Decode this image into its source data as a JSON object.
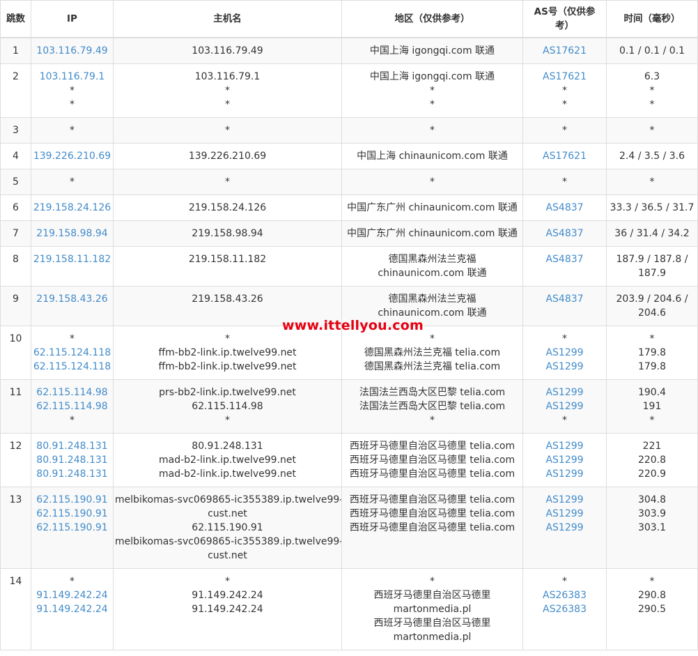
{
  "headers": {
    "hop": "跳数",
    "ip": "IP",
    "host": "主机名",
    "region": "地区（仅供参考）",
    "as": "AS号（仅供参考）",
    "time": "时间（毫秒）"
  },
  "watermark": "www.ittellyou.com",
  "rows": [
    {
      "hop": "1",
      "ip": [
        "103.116.79.49"
      ],
      "host": [
        "103.116.79.49"
      ],
      "region": [
        "中国上海 igongqi.com 联通"
      ],
      "as": [
        "AS17621"
      ],
      "time": [
        "0.1 / 0.1 / 0.1"
      ]
    },
    {
      "hop": "2",
      "ip": [
        "103.116.79.1",
        "*",
        "*"
      ],
      "host": [
        "103.116.79.1",
        "*",
        "*"
      ],
      "region": [
        "中国上海 igongqi.com 联通",
        "*",
        "*"
      ],
      "as": [
        "AS17621",
        "*",
        "*"
      ],
      "time": [
        "6.3",
        "*",
        "*"
      ]
    },
    {
      "hop": "3",
      "ip": [
        "*"
      ],
      "host": [
        "*"
      ],
      "region": [
        "*"
      ],
      "as": [
        "*"
      ],
      "time": [
        "*"
      ]
    },
    {
      "hop": "4",
      "ip": [
        "139.226.210.69"
      ],
      "host": [
        "139.226.210.69"
      ],
      "region": [
        "中国上海 chinaunicom.com 联通"
      ],
      "as": [
        "AS17621"
      ],
      "time": [
        "2.4 / 3.5 / 3.6"
      ]
    },
    {
      "hop": "5",
      "ip": [
        "*"
      ],
      "host": [
        "*"
      ],
      "region": [
        "*"
      ],
      "as": [
        "*"
      ],
      "time": [
        "*"
      ]
    },
    {
      "hop": "6",
      "ip": [
        "219.158.24.126"
      ],
      "host": [
        "219.158.24.126"
      ],
      "region": [
        "中国广东广州 chinaunicom.com 联通"
      ],
      "as": [
        "AS4837"
      ],
      "time": [
        "33.3 / 36.5 / 31.7"
      ]
    },
    {
      "hop": "7",
      "ip": [
        "219.158.98.94"
      ],
      "host": [
        "219.158.98.94"
      ],
      "region": [
        "中国广东广州 chinaunicom.com 联通"
      ],
      "as": [
        "AS4837"
      ],
      "time": [
        "36 / 31.4 / 34.2"
      ]
    },
    {
      "hop": "8",
      "ip": [
        "219.158.11.182"
      ],
      "host": [
        "219.158.11.182"
      ],
      "region": [
        "德国黑森州法兰克福",
        "chinaunicom.com 联通"
      ],
      "as": [
        "AS4837"
      ],
      "time": [
        "187.9 / 187.8 /",
        "187.9"
      ]
    },
    {
      "hop": "9",
      "ip": [
        "219.158.43.26"
      ],
      "host": [
        "219.158.43.26"
      ],
      "region": [
        "德国黑森州法兰克福",
        "chinaunicom.com 联通"
      ],
      "as": [
        "AS4837"
      ],
      "time": [
        "203.9 / 204.6 /",
        "204.6"
      ]
    },
    {
      "hop": "10",
      "ip": [
        "*",
        "62.115.124.118",
        "62.115.124.118"
      ],
      "host": [
        "*",
        "ffm-bb2-link.ip.twelve99.net",
        "ffm-bb2-link.ip.twelve99.net"
      ],
      "region": [
        "*",
        "德国黑森州法兰克福 telia.com",
        "德国黑森州法兰克福 telia.com"
      ],
      "as": [
        "*",
        "AS1299",
        "AS1299"
      ],
      "time": [
        "*",
        "179.8",
        "179.8"
      ]
    },
    {
      "hop": "11",
      "ip": [
        "62.115.114.98",
        "62.115.114.98",
        "*"
      ],
      "host": [
        "prs-bb2-link.ip.twelve99.net",
        "62.115.114.98",
        "*"
      ],
      "region": [
        "法国法兰西岛大区巴黎 telia.com",
        "法国法兰西岛大区巴黎 telia.com",
        "*"
      ],
      "as": [
        "AS1299",
        "AS1299",
        "*"
      ],
      "time": [
        "190.4",
        "191",
        "*"
      ]
    },
    {
      "hop": "12",
      "ip": [
        "80.91.248.131",
        "80.91.248.131",
        "80.91.248.131"
      ],
      "host": [
        "80.91.248.131",
        "mad-b2-link.ip.twelve99.net",
        "mad-b2-link.ip.twelve99.net"
      ],
      "region": [
        "西班牙马德里自治区马德里 telia.com",
        "西班牙马德里自治区马德里 telia.com",
        "西班牙马德里自治区马德里 telia.com"
      ],
      "as": [
        "AS1299",
        "AS1299",
        "AS1299"
      ],
      "time": [
        "221",
        "220.8",
        "220.9"
      ]
    },
    {
      "hop": "13",
      "ip": [
        "62.115.190.91",
        "62.115.190.91",
        "62.115.190.91"
      ],
      "host": [
        "melbikomas-svc069865-ic355389.ip.twelve99-",
        "cust.net",
        "62.115.190.91",
        "melbikomas-svc069865-ic355389.ip.twelve99-",
        "cust.net"
      ],
      "region": [
        "西班牙马德里自治区马德里 telia.com",
        "西班牙马德里自治区马德里 telia.com",
        "西班牙马德里自治区马德里 telia.com"
      ],
      "as": [
        "AS1299",
        "AS1299",
        "AS1299"
      ],
      "time": [
        "304.8",
        "303.9",
        "303.1"
      ]
    },
    {
      "hop": "14",
      "ip": [
        "*",
        "91.149.242.24",
        "91.149.242.24"
      ],
      "host": [
        "*",
        "91.149.242.24",
        "91.149.242.24"
      ],
      "region": [
        "*",
        "西班牙马德里自治区马德里",
        "martonmedia.pl",
        "西班牙马德里自治区马德里",
        "martonmedia.pl"
      ],
      "as": [
        "*",
        "AS26383",
        "AS26383"
      ],
      "time": [
        "*",
        "290.8",
        "290.5"
      ]
    }
  ]
}
